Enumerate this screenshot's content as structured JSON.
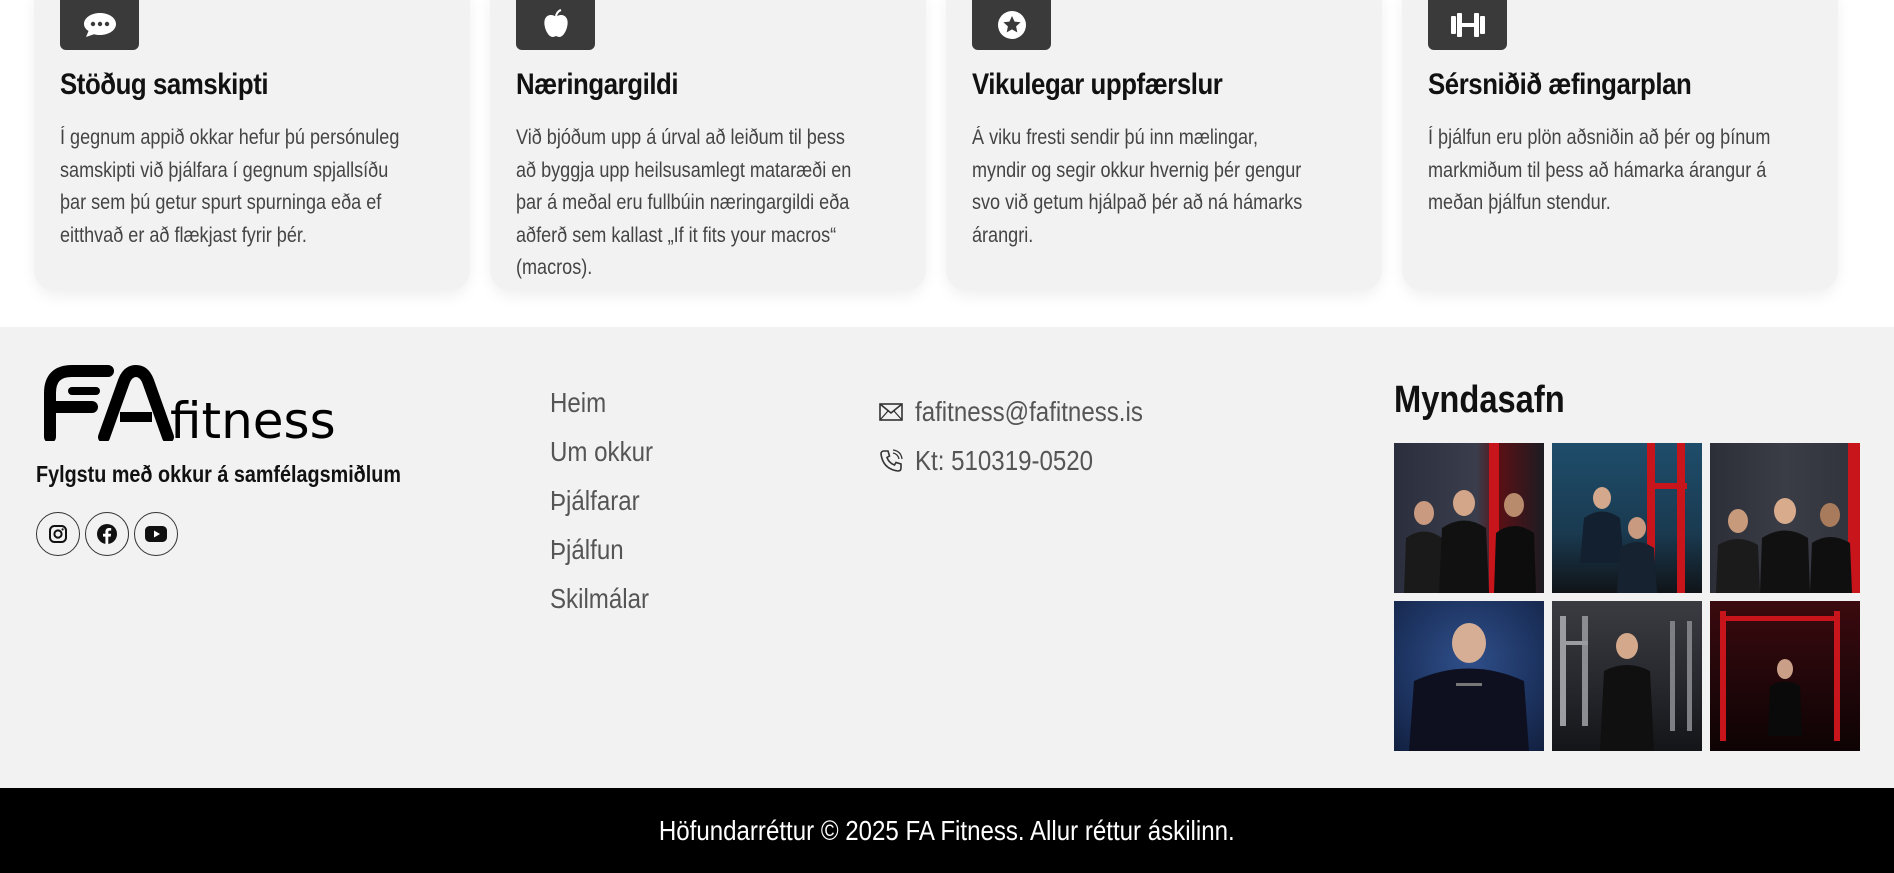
{
  "features": [
    {
      "icon": "chat-bubble-icon",
      "title": "Stöðug samskipti",
      "text": "Í gegnum appið okkar hefur þú persónuleg samskipti við þjálfara í gegnum spjallsíðu þar sem þú getur spurt spurninga eða ef eitthvað er að flækjast fyrir þér."
    },
    {
      "icon": "apple-icon",
      "title": "Næringargildi",
      "text": "Við bjóðum upp á úrval að leiðum til þess að byggja upp heilsusamlegt mataræði en þar á meðal eru fullbúin næringargildi eða aðferð sem kallast „If it fits your macros“ (macros)."
    },
    {
      "icon": "star-badge-icon",
      "title": "Vikulegar uppfærslur",
      "text": "Á viku fresti sendir þú inn mælingar, myndir og segir okkur hvernig þér gengur svo við getum hjálpað þér að ná hámarks árangri."
    },
    {
      "icon": "dumbbell-icon",
      "title": "Sérsniðið æfingarplan",
      "text": "Í þjálfun eru plön aðsniðin að þér og þínum markmiðum til þess að hámarka árangur á meðan þjálfun stendur."
    }
  ],
  "footer": {
    "logo_text": "FA fitness",
    "follow_text": "Fylgstu með okkur á samfélagsmiðlum",
    "socials": [
      "instagram-icon",
      "facebook-icon",
      "youtube-icon"
    ],
    "nav": [
      "Heim",
      "Um okkur",
      "Þjálfarar",
      "Þjálfun",
      "Skilmálar"
    ],
    "email": "fafitness@fafitness.is",
    "kt": "Kt: 510319-0520",
    "gallery_title": "Myndasafn",
    "copyright": "Höfundarréttur © 2025 FA Fitness. Allur réttur áskilinn."
  },
  "colors": {
    "card_bg": "#f2f2f2",
    "icon_box": "#3a3a3a",
    "footer_bg": "#f2f2f2",
    "copyright_bg": "#000000",
    "accent_red": "#c8151b"
  }
}
